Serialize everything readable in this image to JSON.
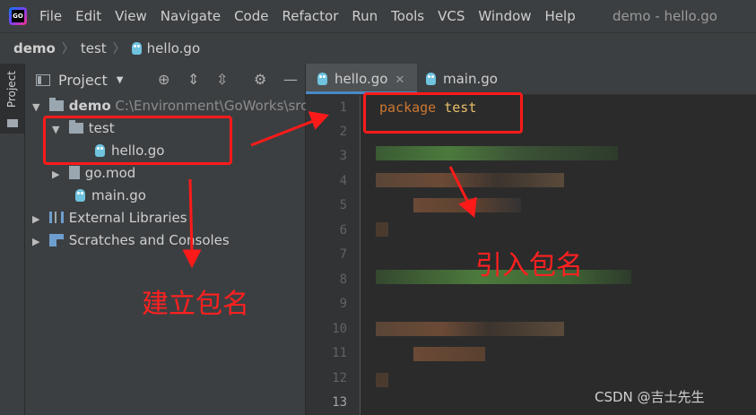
{
  "menubar": {
    "logo_text": "GO",
    "items": [
      "File",
      "Edit",
      "View",
      "Navigate",
      "Code",
      "Refactor",
      "Run",
      "Tools",
      "VCS",
      "Window",
      "Help"
    ],
    "window_title": "demo - hello.go"
  },
  "breadcrumb": {
    "root": "demo",
    "folder": "test",
    "file": "hello.go"
  },
  "sidebar_strip": {
    "label": "Project"
  },
  "project_panel": {
    "title": "Project",
    "tree": {
      "root_name": "demo",
      "root_path": "C:\\Environment\\GoWorks\\src",
      "folder_test": "test",
      "file_hello": "hello.go",
      "file_gomod": "go.mod",
      "file_main": "main.go",
      "external_libraries": "External Libraries",
      "scratches": "Scratches and Consoles"
    }
  },
  "editor": {
    "tabs": [
      {
        "label": "hello.go",
        "active": true
      },
      {
        "label": "main.go",
        "active": false
      }
    ],
    "line_numbers": [
      "1",
      "2",
      "3",
      "4",
      "5",
      "6",
      "7",
      "8",
      "9",
      "10",
      "11",
      "12",
      "13"
    ],
    "current_line": "13",
    "code_keyword": "package",
    "code_package_name": "test"
  },
  "annotations": {
    "create_package": "建立包名",
    "import_package": "引入包名"
  },
  "watermark": "CSDN @吉士先生",
  "colors": {
    "annotation_red": "#ff1a1a",
    "keyword_orange": "#cc7832",
    "package_yellow": "#e8bf6a"
  }
}
